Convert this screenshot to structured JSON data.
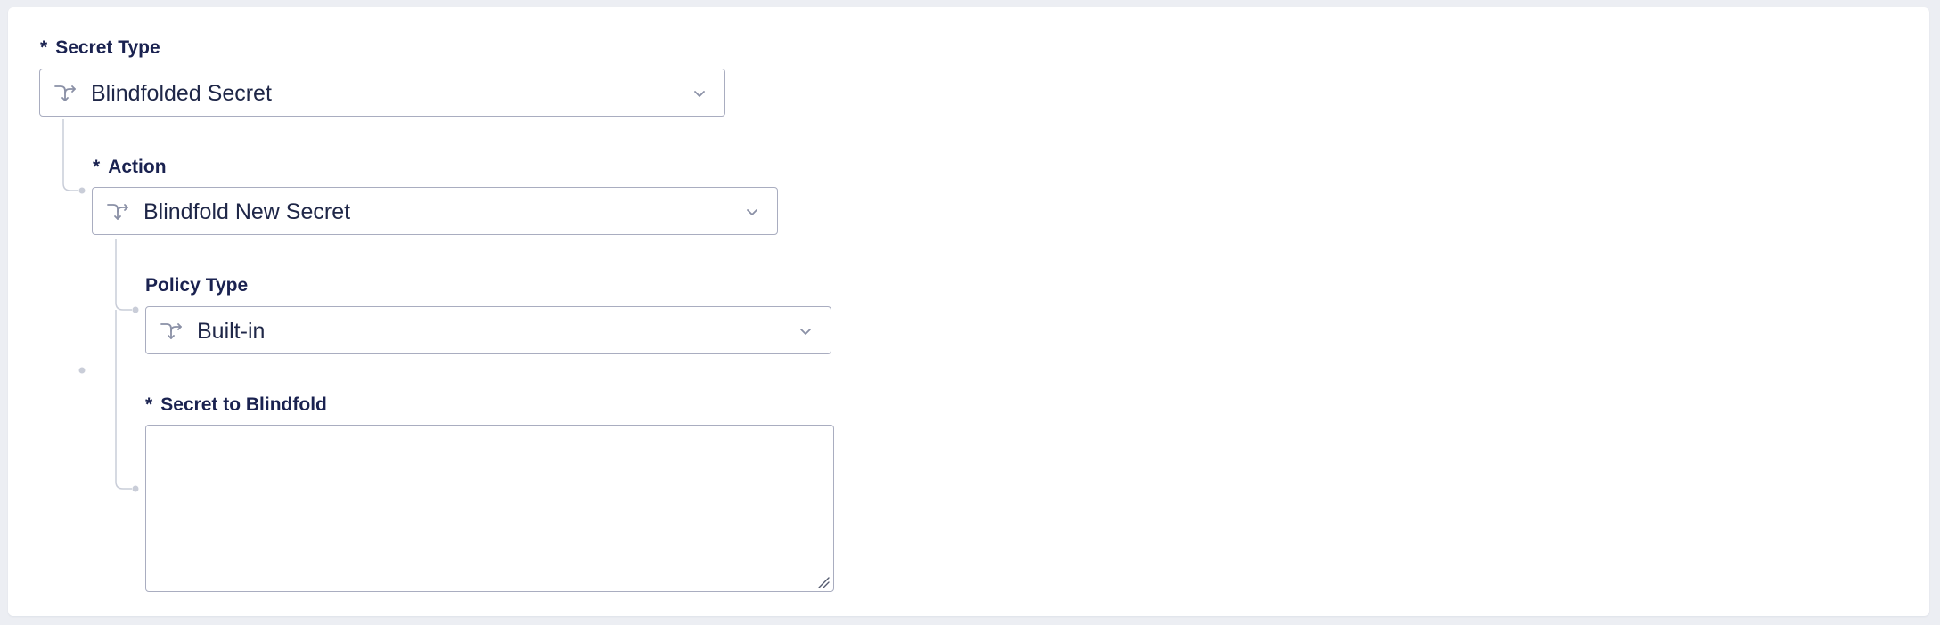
{
  "form": {
    "secret_type": {
      "required_mark": "*",
      "label": "Secret Type",
      "value": "Blindfolded Secret"
    },
    "action": {
      "required_mark": "*",
      "label": "Action",
      "value": "Blindfold New Secret"
    },
    "policy_type": {
      "label": "Policy Type",
      "value": "Built-in"
    },
    "secret_to_blindfold": {
      "required_mark": "*",
      "label": "Secret to Blindfold",
      "value": ""
    }
  },
  "icons": {
    "select_icon": "shuffle-arrows-icon",
    "dropdown_icon": "chevron-down-icon",
    "resize_icon": "resize-handle-icon"
  },
  "colors": {
    "label_text": "#1a2250",
    "border": "#a9adc0",
    "tree_line": "#c9cdd8",
    "background": "#eceef3"
  }
}
